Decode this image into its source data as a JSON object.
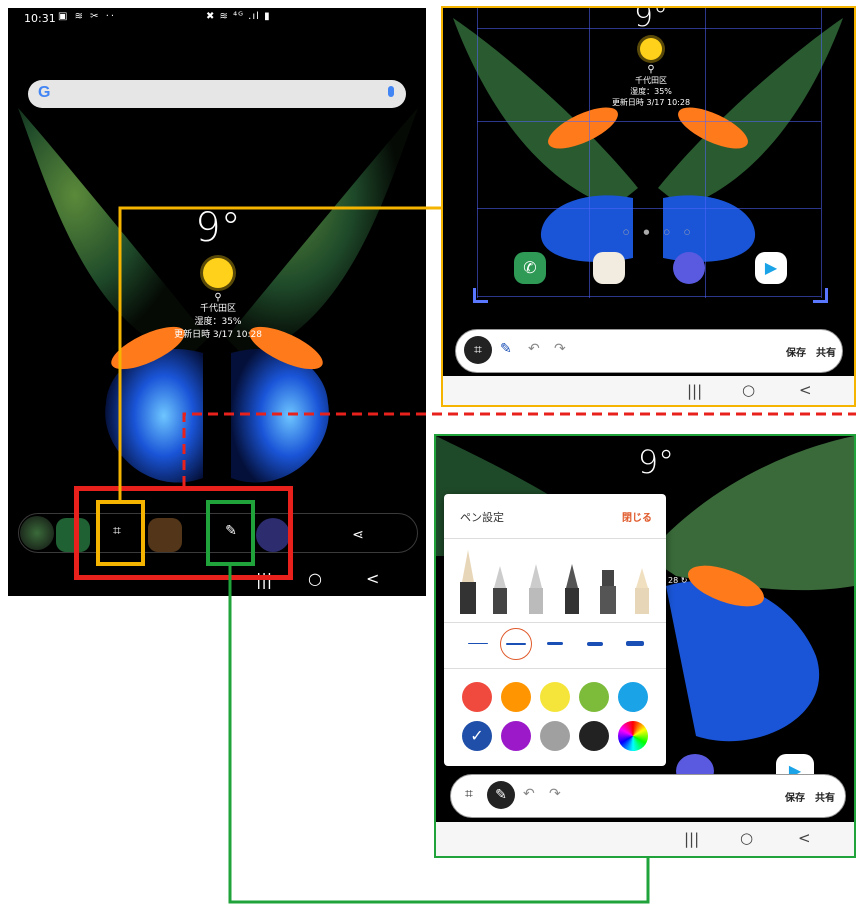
{
  "left_phone": {
    "status_time": "10:31",
    "status_left_icons": "▣ ≋ ✂ ··",
    "status_right_icons": "✖ ≋ ⁴ᴳ .ıl ▮",
    "search": {
      "logo": "G"
    },
    "weather": {
      "temperature": "9°",
      "location": "千代田区",
      "humidity": "湿度：35%",
      "updated": "更新日時 3/17 10:28"
    },
    "nav": {
      "recent": "|||",
      "home": "○",
      "back": "<"
    }
  },
  "right_top_phone": {
    "weather": {
      "temperature": "9°",
      "location": "千代田区",
      "humidity": "湿度：35%",
      "updated": "更新日時 3/17 10:28"
    },
    "page_dots": "○ ● ○ ○",
    "toolbar": {
      "save": "保存",
      "share": "共有"
    },
    "nav": {
      "recent": "|||",
      "home": "○",
      "back": "<"
    }
  },
  "right_bottom_phone": {
    "weather": {
      "temperature": "9°",
      "updated_partial": "28"
    },
    "pen_settings": {
      "title": "ペン設定",
      "close": "閉じる",
      "pen_types": [
        "fountain-pen",
        "calligraphy-pen",
        "pen",
        "pencil",
        "marker",
        "highlighter"
      ],
      "stroke_sizes": [
        1,
        2,
        3,
        4,
        5
      ],
      "selected_stroke": 1,
      "colors": [
        "#f04a3e",
        "#ff9500",
        "#f5e53a",
        "#7dbb3a",
        "#1aa3e6",
        "#1f4fa8",
        "#9b19c9",
        "#a0a0a0",
        "#222222",
        "conic"
      ],
      "selected_color": 5
    },
    "toolbar": {
      "save": "保存",
      "share": "共有"
    },
    "nav": {
      "recent": "|||",
      "home": "○",
      "back": "<"
    }
  },
  "colors": {
    "highlight_red": "#e8211d",
    "highlight_orange": "#f5b400",
    "highlight_green": "#1fa33a"
  }
}
